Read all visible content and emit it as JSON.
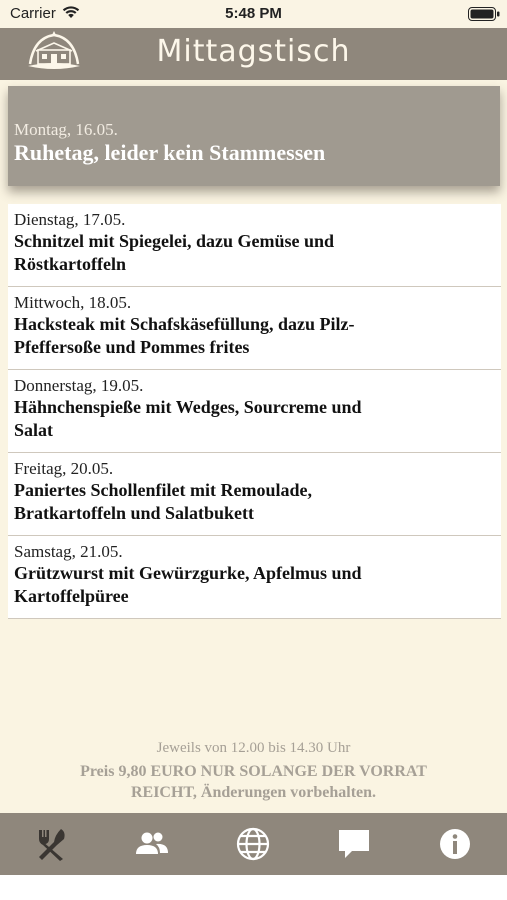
{
  "status_bar": {
    "carrier": "Carrier",
    "time": "5:48 PM"
  },
  "header": {
    "title": "Mittagstisch",
    "logo_icon": "restaurant-building-logo"
  },
  "featured": {
    "date": "Montag, 16.05.",
    "dish": "Ruhetag, leider kein Stammessen"
  },
  "menu": [
    {
      "date": "Dienstag, 17.05.",
      "dish_line1": "Schnitzel mit Spiegelei, dazu Gemüse und",
      "dish_line2": "Röstkartoffeln"
    },
    {
      "date": "Mittwoch, 18.05.",
      "dish_line1": "Hacksteak mit Schafskäsefüllung, dazu Pilz-",
      "dish_line2": "Pfeffersoße und Pommes frites"
    },
    {
      "date": "Donnerstag, 19.05.",
      "dish_line1": "Hähnchenspieße mit Wedges, Sourcreme und",
      "dish_line2": "Salat"
    },
    {
      "date": "Freitag, 20.05.",
      "dish_line1": "Paniertes Schollenfilet mit Remoulade,",
      "dish_line2": "Bratkartoffeln und Salatbukett"
    },
    {
      "date": "Samstag, 21.05.",
      "dish_line1": "Grützwurst mit Gewürzgurke, Apfelmus und",
      "dish_line2": "Kartoffelpüree"
    }
  ],
  "footer": {
    "hours": "Jeweils von 12.00 bis 14.30 Uhr",
    "price_line1": "Preis 9,80 EURO NUR SOLANGE DER VORRAT",
    "price_line2": "REICHT, Änderungen vorbehalten."
  },
  "tabs": [
    {
      "icon": "fork-knife-icon",
      "active": true
    },
    {
      "icon": "people-icon",
      "active": false
    },
    {
      "icon": "globe-icon",
      "active": false
    },
    {
      "icon": "chat-bubble-icon",
      "active": false
    },
    {
      "icon": "info-icon",
      "active": false
    }
  ],
  "colors": {
    "bar": "#8f877c",
    "background": "#faf4e2",
    "featured": "#a09a90",
    "tab_active": "#3a3632",
    "tab_inactive": "#ffffff"
  }
}
